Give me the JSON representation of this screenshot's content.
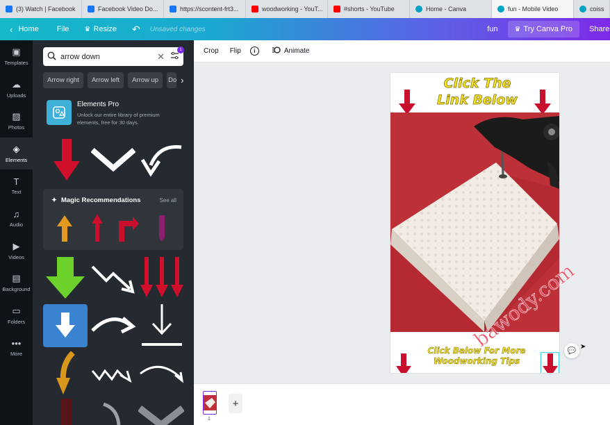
{
  "browser_tabs": [
    {
      "title": "(3) Watch | Facebook",
      "icon": "facebook-icon",
      "active": false
    },
    {
      "title": "Facebook Video Do...",
      "icon": "facebook-icon",
      "active": false
    },
    {
      "title": "https://scontent-frt3...",
      "icon": "facebook-icon",
      "active": false
    },
    {
      "title": "woodworking - YouT...",
      "icon": "youtube-icon",
      "active": false
    },
    {
      "title": "#shorts - YouTube",
      "icon": "youtube-icon",
      "active": false
    },
    {
      "title": "Home - Canva",
      "icon": "canva-icon",
      "active": false
    },
    {
      "title": "fun - Mobile Video",
      "icon": "canva-icon",
      "active": true
    },
    {
      "title": "coiss",
      "icon": "canva-icon",
      "active": false
    }
  ],
  "topbar": {
    "home": "Home",
    "file": "File",
    "resize": "Resize",
    "unsaved": "Unsaved changes",
    "doc_title": "fun",
    "try_pro": "Try Canva Pro",
    "share": "Share"
  },
  "rail": [
    {
      "label": "Templates",
      "icon": "templates-icon"
    },
    {
      "label": "Uploads",
      "icon": "upload-icon"
    },
    {
      "label": "Photos",
      "icon": "photos-icon"
    },
    {
      "label": "Elements",
      "icon": "elements-icon",
      "active": true
    },
    {
      "label": "Text",
      "icon": "text-icon"
    },
    {
      "label": "Audio",
      "icon": "audio-icon"
    },
    {
      "label": "Videos",
      "icon": "videos-icon"
    },
    {
      "label": "Background",
      "icon": "background-icon"
    },
    {
      "label": "Folders",
      "icon": "folder-icon"
    },
    {
      "label": "More",
      "icon": "more-icon"
    }
  ],
  "panel": {
    "search_value": "arrow down",
    "filter_badge": "1",
    "chips": [
      "Arrow right",
      "Arrow left",
      "Arrow up",
      "Down"
    ],
    "pro_title": "Elements Pro",
    "pro_desc_1": "Unlock our entire library of premium",
    "pro_desc_2": "elements, free for 30 days.",
    "magic_title": "Magic Recommendations",
    "magic_see_all": "See all"
  },
  "context_toolbar": {
    "crop": "Crop",
    "flip": "Flip",
    "animate": "Animate"
  },
  "design": {
    "header_line1": "Click The",
    "header_line2": "Link Below",
    "footer_line1": "Click Below For More",
    "footer_line2": "Woodworking Tips",
    "arrow_color": "#c8102e",
    "text_color": "#f5e02a"
  },
  "pages": {
    "page_number": "1"
  },
  "watermark": "bawody.com",
  "colors": {
    "accent": "#7d2ae8",
    "teal": "#15b8c9",
    "selection": "#3fcbe0"
  }
}
